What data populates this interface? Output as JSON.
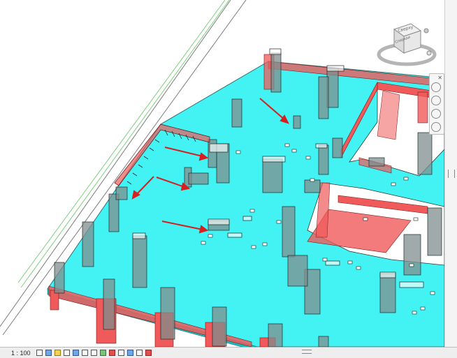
{
  "statusbar": {
    "scale": "1 : 100",
    "icons": [
      "detail-level-icon",
      "visual-style-icon",
      "sun-path-icon",
      "shadows-icon",
      "crop-view-icon",
      "show-crop-icon",
      "unlock-3d-icon",
      "temporary-hide-icon",
      "reveal-hidden-icon",
      "temp-view-props-icon",
      "analytical-model-icon",
      "highlight-displacement-icon",
      "constraints-icon"
    ]
  },
  "viewcube": {
    "top_face": "Сверху",
    "front_face": "Спереди"
  },
  "colors": {
    "slab": "#22f1f1",
    "beam": "#f05a5a",
    "arrow": "#d81e1e",
    "column": "#7f8a8a"
  }
}
